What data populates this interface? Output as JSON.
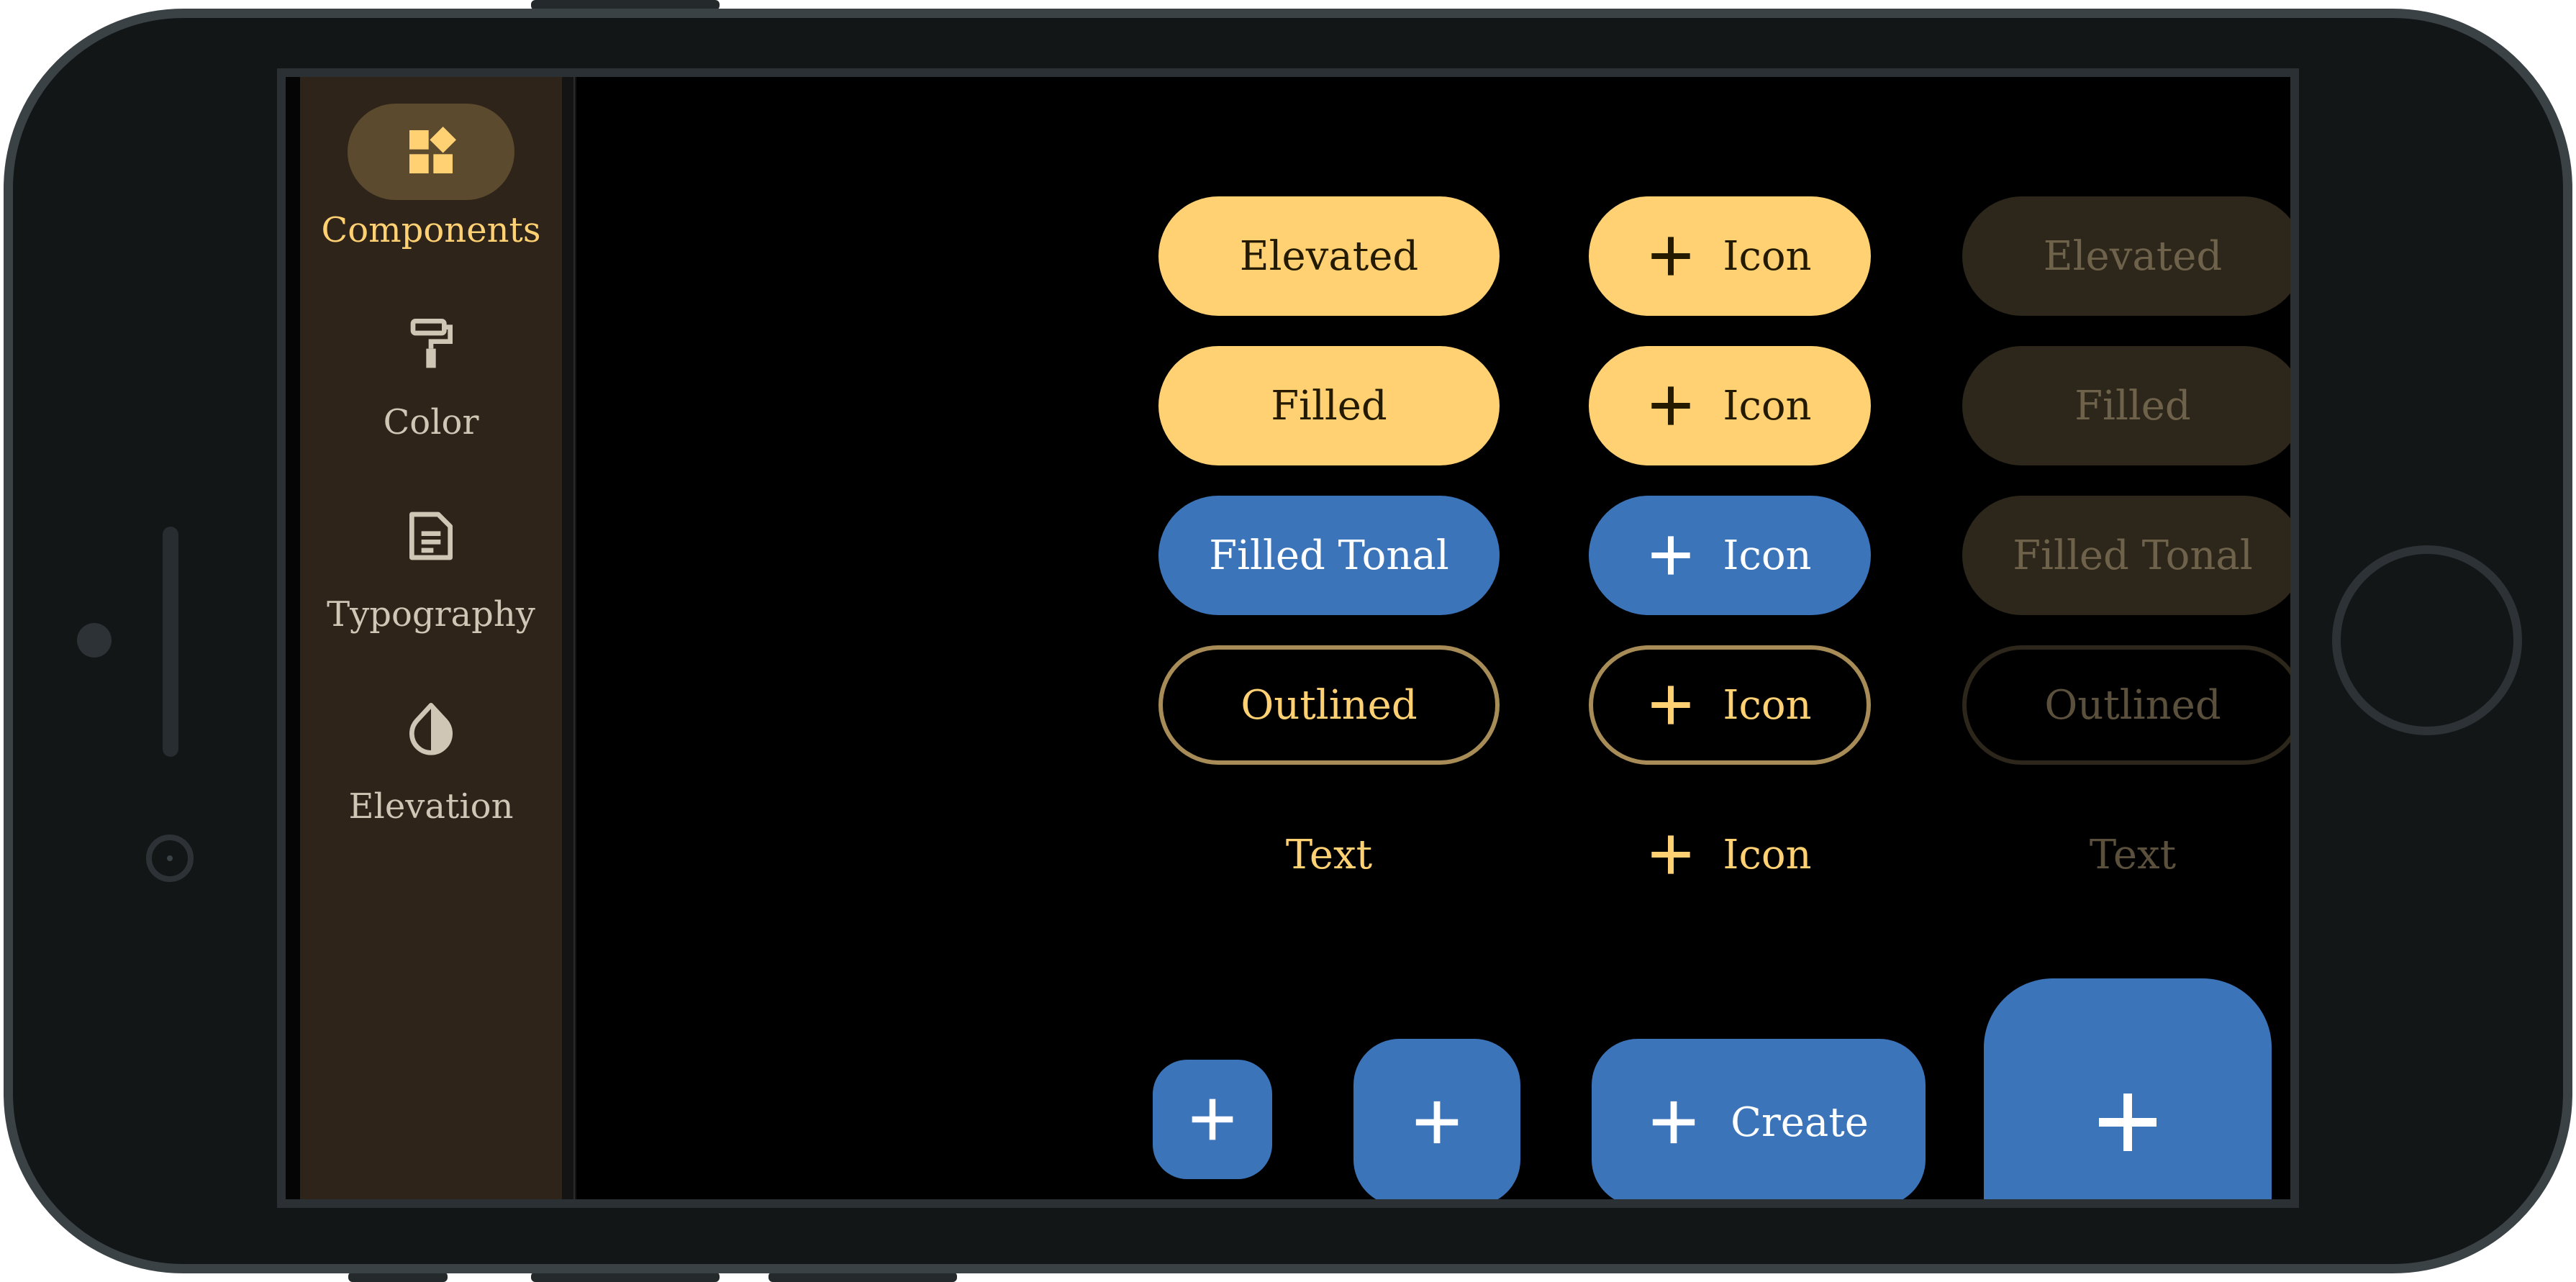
{
  "navigation_rail": {
    "items": [
      {
        "label": "Components",
        "icon": "components-icon",
        "active": true
      },
      {
        "label": "Color",
        "icon": "paint-roller-icon",
        "active": false
      },
      {
        "label": "Typography",
        "icon": "document-icon",
        "active": false
      },
      {
        "label": "Elevation",
        "icon": "opacity-drop-icon",
        "active": false
      }
    ]
  },
  "buttons": {
    "enabled": {
      "elevated": "Elevated",
      "filled": "Filled",
      "filled_tonal": "Filled Tonal",
      "outlined": "Outlined",
      "text": "Text"
    },
    "with_icon": {
      "elevated": "Icon",
      "filled": "Icon",
      "filled_tonal": "Icon",
      "outlined": "Icon",
      "text": "Icon"
    },
    "disabled": {
      "elevated": "Elevated",
      "filled": "Filled",
      "filled_tonal": "Filled Tonal",
      "outlined": "Outlined",
      "text": "Text"
    }
  },
  "fabs": {
    "small_icon": "add-icon",
    "regular_icon": "add-icon",
    "extended_label": "Create",
    "large_icon": "add-icon"
  },
  "colors": {
    "primary": "#ffd173",
    "tonal": "#3c74ba",
    "rail_background": "#2e241a",
    "rail_indicator": "#5b4a2e",
    "surface": "#000000"
  }
}
